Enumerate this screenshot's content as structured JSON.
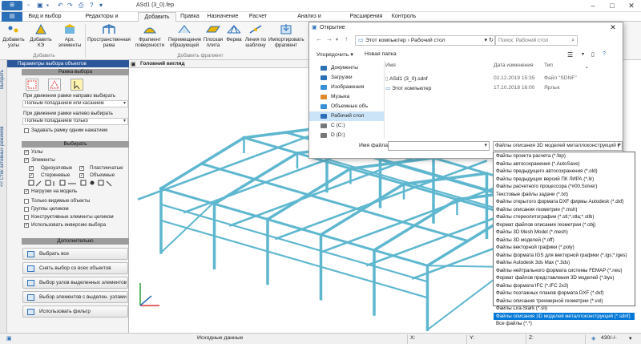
{
  "titlebar": {
    "app_button": "⊞",
    "title": "ASd1 (3_0).fep"
  },
  "menu": [
    "Вид и выбор",
    "Редакторы и конструирование",
    "Добавить",
    "Правка",
    "Назначение",
    "Расчет",
    "Анализ и документирование",
    "Расширения",
    "Контроль"
  ],
  "menu_active_index": 2,
  "ribbon": {
    "buttons": [
      {
        "label": "Добавить узлы"
      },
      {
        "label": "Добавить КЭ"
      },
      {
        "label": "Арх. элементы"
      },
      {
        "label": "Пространственная рама"
      },
      {
        "label": "Фрагмент поверхности"
      },
      {
        "label": "Перемещение образующей"
      },
      {
        "label": "Плоская плита"
      },
      {
        "label": "Ферма"
      },
      {
        "label": "Линия по шаблону"
      },
      {
        "label": "Импортировать фрагмент"
      }
    ],
    "groups": [
      "Добавить",
      "Добавить фрагмент"
    ]
  },
  "left_strip": {
    "items": [
      "Выбрать",
      "<< Стек активных режимов"
    ]
  },
  "panel": {
    "header": "Параметры выбора объектов",
    "frame_section": "Рамка выбора",
    "drag_right_label": "При движении рамки направо выбирать",
    "drag_right_value": "Полным попаданием или касанием",
    "drag_left_label": "При движении рамки налево выбирать",
    "drag_left_value": "Полным попаданием только",
    "single_click": "Задавать рамку одним нажатием",
    "select_section": "Выбирать",
    "nodes": "Узлы",
    "elements": "Элементы",
    "single_node": "Одноузловые",
    "plate": "Пластинчатые",
    "rod": "Стержневые",
    "volume": "Объемные",
    "loads": "Нагрузки на модель",
    "visible_only": "Только видимые объекты",
    "groups_whole": "Группы целиком",
    "constructive": "Конструктивные элементы целиком",
    "inverse": "Использовать инверсию выбора",
    "extra_section": "Дополнительно",
    "buttons": [
      "Выбрать все",
      "Снять выбор со всех объектов",
      "Выбор узлов выделенных элементов",
      "Выбор элементов с выделен. узлами",
      "Использовать фильтр"
    ]
  },
  "view": {
    "tab": "Головний вигляд"
  },
  "statusbar": {
    "mode": "Исходные данные",
    "x": "X:",
    "y": "Y:",
    "z": "Z:",
    "zoom": "430/-/-"
  },
  "dialog": {
    "title": "Открытие",
    "path_root": "Этот компьютер",
    "path_leaf": "Рабочий стол",
    "search_placeholder": "Поиск: Рабочий стол",
    "organize": "Упорядочить",
    "new_folder": "Новая папка",
    "nav": [
      "Документы",
      "Загрузки",
      "Изображения",
      "Музыка",
      "Объемные объ",
      "Рабочий стол",
      "C (C:)",
      "D (D:)"
    ],
    "nav_selected_index": 5,
    "columns": [
      "Имя",
      "Дата изменения",
      "Тип"
    ],
    "files": [
      {
        "name": "ASd1 (3_0).sdnf",
        "date": "02.12.2019 15:35",
        "type": "Файл \"SDNF\""
      },
      {
        "name": "Этот компьютер",
        "date": "17.10.2018 16:00",
        "type": "Ярлык"
      }
    ],
    "filename_label": "Имя файла:",
    "filetype_value": "Файлы описания 3D моделей металлоконструкций (*.sdnf)"
  },
  "filetype_options": [
    "Файлы проекта расчета (*.fep)",
    "Файлы автосохранения (*.AutoSave)",
    "Файлы предыдущего автосохранения (*.old)",
    "Файлы предыдущих версий ПК ЛИРА (*.lir)",
    "Файлы расчетного процессора (*#00.Solver)",
    "Текстовые файлы задачи (*.txt)",
    "Файлы открытого формата DXF фирмы Autodesk (*.dxf)",
    "Файлы описания геометрии (*.msh)",
    "Файлы стереолитографии (*.stl;*.stla;*.stlb)",
    "Формат файлов описания геометрии (*.obj)",
    "Файлы 3D Mesh Model (*.mesh)",
    "Файлы 3D моделей (*.off)",
    "Файлы векторной графики (*.poly)",
    "Файлы формата IGS для векторной графики (*.igs;*.iges)",
    "Файлы Autodesk 3ds Max (*.3ds)",
    "Файлы нейтрального формата системы FEMAP (*.neu)",
    "Формат файлов представления 3D моделей (*.byu)",
    "Файлы формата IFC (*.IFC 2x3)",
    "Файлы поэтажных планов формата DXF (*.dxf)",
    "Файлы описания трехмерной геометрии (*.vol)",
    "Файлы Lira-Stark (*.sli)",
    "Файлы описания 3D моделей металлоконструкций (*.sdnf)",
    "Все файлы (*.*)"
  ],
  "filetype_selected_index": 21,
  "colors": {
    "accent": "#2b579a",
    "frame": "#5eb7cf",
    "selection": "#0078d7"
  }
}
